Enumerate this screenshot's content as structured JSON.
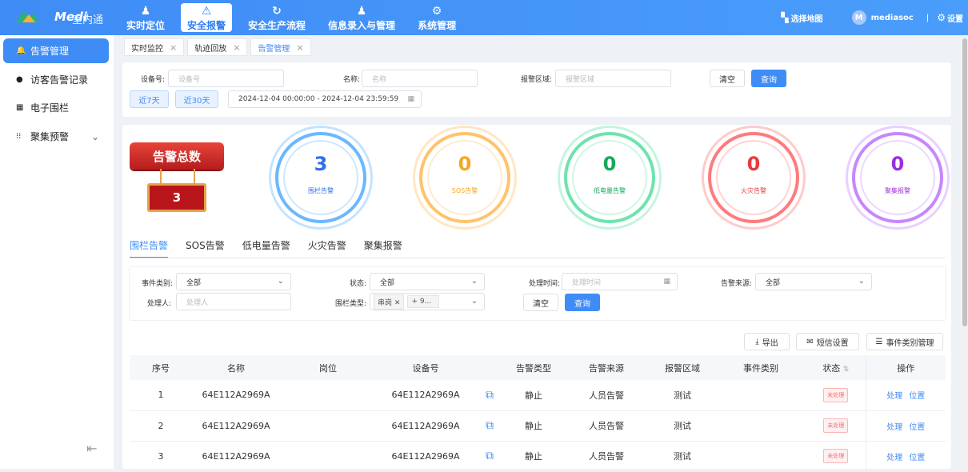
{
  "brand": {
    "logo": "Medi",
    "logo_sub": "迈迪科技",
    "app": "室内通"
  },
  "nav": [
    {
      "label": "实时定位",
      "icon": "person-pin-icon",
      "glyph": "♟"
    },
    {
      "label": "安全报警",
      "icon": "alarm-light-icon",
      "glyph": "⚠"
    },
    {
      "label": "安全生产流程",
      "icon": "cycle-icon",
      "glyph": "↻"
    },
    {
      "label": "信息录入与管理",
      "icon": "person-edit-icon",
      "glyph": "♟"
    },
    {
      "label": "系统管理",
      "icon": "gear-display-icon",
      "glyph": "⚙"
    }
  ],
  "topright": {
    "map": "选择地图",
    "user_initial": "M",
    "user": "mediasoc",
    "separator": "|",
    "settings": "设置"
  },
  "sidebar": {
    "items": [
      {
        "label": "告警管理",
        "glyph": "🔔"
      },
      {
        "label": "访客告警记录",
        "glyph": "●"
      },
      {
        "label": "电子围栏",
        "glyph": "▦"
      },
      {
        "label": "聚集预警",
        "glyph": "⁝⁝",
        "chevron": "⌄"
      }
    ],
    "collapse": "⇤"
  },
  "tabs": [
    {
      "label": "实时监控"
    },
    {
      "label": "轨迹回放"
    },
    {
      "label": "告警管理"
    }
  ],
  "tab_close": "×",
  "search": {
    "device_label": "设备号:",
    "device_ph": "设备号",
    "name_label": "名称:",
    "name_ph": "名称",
    "area_label": "报警区域:",
    "area_ph": "报警区域",
    "clear": "清空",
    "query": "查询",
    "last7": "近7天",
    "last30": "近30天",
    "daterange": "2024-12-04 00:00:00 - 2024-12-04 23:59:59"
  },
  "total": {
    "label": "告警总数",
    "value": "3"
  },
  "rings": [
    {
      "value": "3",
      "label": "围栏告警",
      "color": "#2f6fe8",
      "ring": "#6ab8ff"
    },
    {
      "value": "0",
      "label": "SOS告警",
      "color": "#f5a623",
      "ring": "#ffc36b"
    },
    {
      "value": "0",
      "label": "低电量告警",
      "color": "#16a85a",
      "ring": "#6fe3ad"
    },
    {
      "value": "0",
      "label": "火灾告警",
      "color": "#e83a3a",
      "ring": "#ff7b7b"
    },
    {
      "value": "0",
      "label": "聚集报警",
      "color": "#9b2ee0",
      "ring": "#c786ff"
    }
  ],
  "alarm_tabs": [
    "围栏告警",
    "SOS告警",
    "低电量告警",
    "火灾告警",
    "聚集报警"
  ],
  "filter": {
    "event_label": "事件类别:",
    "event_value": "全部",
    "status_label": "状态:",
    "status_value": "全部",
    "handle_time_label": "处理时间:",
    "handle_time_ph": "处理时间",
    "source_label": "告警来源:",
    "source_value": "全部",
    "handler_label": "处理人:",
    "handler_ph": "处理人",
    "fence_label": "围栏类型:",
    "fence_tag": "串岗",
    "fence_more": "+ 9...",
    "clear": "清空",
    "query": "查询"
  },
  "actions": {
    "export": "导出",
    "sms": "短信设置",
    "event_mgmt": "事件类别管理"
  },
  "table": {
    "headers": [
      "序号",
      "名称",
      "岗位",
      "设备号",
      "告警类型",
      "告警来源",
      "报警区域",
      "事件类别",
      "状态",
      "操作"
    ],
    "rows": [
      {
        "no": "1",
        "name": "64E112A2969A",
        "post": "",
        "device": "64E112A2969A",
        "type": "静止",
        "source": "人员告警",
        "area": "测试",
        "event": "",
        "status": "未处理",
        "op1": "处理",
        "op2": "位置"
      },
      {
        "no": "2",
        "name": "64E112A2969A",
        "post": "",
        "device": "64E112A2969A",
        "type": "静止",
        "source": "人员告警",
        "area": "测试",
        "event": "",
        "status": "未处理",
        "op1": "处理",
        "op2": "位置"
      },
      {
        "no": "3",
        "name": "64E112A2969A",
        "post": "",
        "device": "64E112A2969A",
        "type": "静止",
        "source": "人员告警",
        "area": "测试",
        "event": "",
        "status": "未处理",
        "op1": "处理",
        "op2": "位置"
      }
    ]
  }
}
